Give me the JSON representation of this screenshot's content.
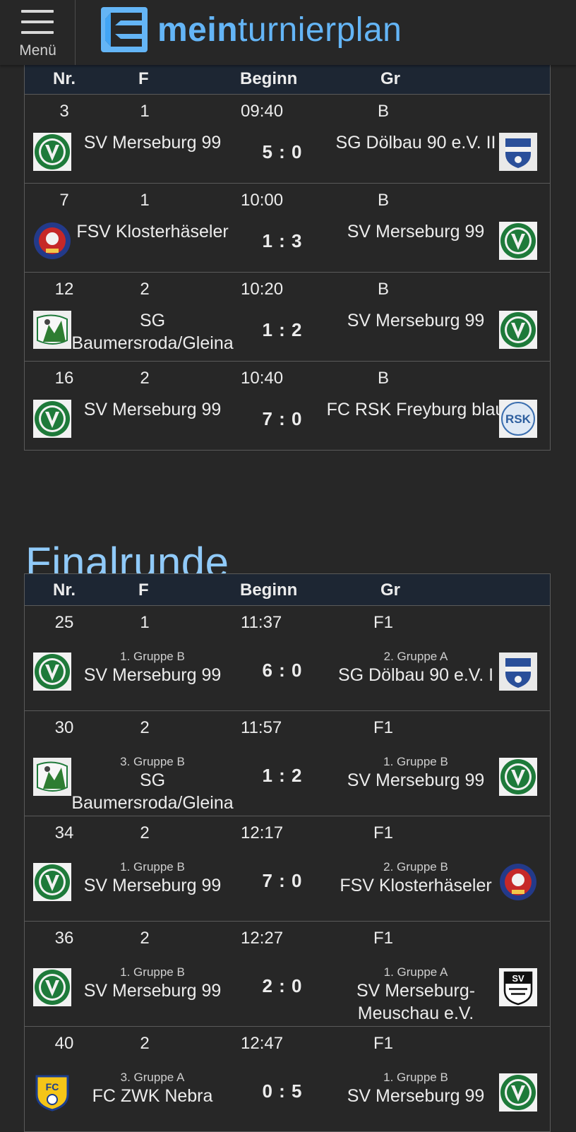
{
  "header": {
    "menu_label": "Menü",
    "logo_bold": "mein",
    "logo_rest": "turnierplan"
  },
  "columns": {
    "nr": "Nr.",
    "f": "F",
    "beginn": "Beginn",
    "gr": "Gr"
  },
  "group_matches": [
    {
      "nr": "3",
      "f": "1",
      "time": "09:40",
      "gr": "B",
      "home": "SV Merseburg 99",
      "home_logo": "sv-merseburg-99-crest",
      "score": "5 : 0",
      "away": "SG Dölbau 90 e.V. II",
      "away_logo": "sg-doelbau-crest"
    },
    {
      "nr": "7",
      "f": "1",
      "time": "10:00",
      "gr": "B",
      "home": "FSV Klosterhäseler",
      "home_logo": "fsv-klosterhaeseler-crest",
      "score": "1 : 3",
      "away": "SV Merseburg 99",
      "away_logo": "sv-merseburg-99-crest"
    },
    {
      "nr": "12",
      "f": "2",
      "time": "10:20",
      "gr": "B",
      "home": "SG Baumersroda/Gleina",
      "home_logo": "sg-baumersroda-crest",
      "score": "1 : 2",
      "away": "SV Merseburg 99",
      "away_logo": "sv-merseburg-99-crest"
    },
    {
      "nr": "16",
      "f": "2",
      "time": "10:40",
      "gr": "B",
      "home": "SV Merseburg 99",
      "home_logo": "sv-merseburg-99-crest",
      "score": "7 : 0",
      "away": "FC RSK Freyburg blau",
      "away_logo": "fc-rsk-freyburg-crest"
    }
  ],
  "final_round": {
    "title": "Finalrunde",
    "matches": [
      {
        "nr": "25",
        "f": "1",
        "time": "11:37",
        "gr": "F1",
        "home_src": "1. Gruppe B",
        "home": "SV Merseburg 99",
        "home_logo": "sv-merseburg-99-crest",
        "score": "6 : 0",
        "away_src": "2. Gruppe A",
        "away": "SG Dölbau 90 e.V. I",
        "away_logo": "sg-doelbau-crest"
      },
      {
        "nr": "30",
        "f": "2",
        "time": "11:57",
        "gr": "F1",
        "home_src": "3. Gruppe B",
        "home": "SG Baumersroda/Gleina",
        "home_logo": "sg-baumersroda-crest",
        "score": "1 : 2",
        "away_src": "1. Gruppe B",
        "away": "SV Merseburg 99",
        "away_logo": "sv-merseburg-99-crest"
      },
      {
        "nr": "34",
        "f": "2",
        "time": "12:17",
        "gr": "F1",
        "home_src": "1. Gruppe B",
        "home": "SV Merseburg 99",
        "home_logo": "sv-merseburg-99-crest",
        "score": "7 : 0",
        "away_src": "2. Gruppe B",
        "away": "FSV Klosterhäseler",
        "away_logo": "fsv-klosterhaeseler-crest"
      },
      {
        "nr": "36",
        "f": "2",
        "time": "12:27",
        "gr": "F1",
        "home_src": "1. Gruppe B",
        "home": "SV Merseburg 99",
        "home_logo": "sv-merseburg-99-crest",
        "score": "2 : 0",
        "away_src": "1. Gruppe A",
        "away": "SV Merseburg-Meuschau e.V.",
        "away_logo": "sv-merseburg-meuschau-crest"
      },
      {
        "nr": "40",
        "f": "2",
        "time": "12:47",
        "gr": "F1",
        "home_src": "3. Gruppe A",
        "home": "FC ZWK Nebra",
        "home_logo": "fc-zwk-nebra-crest",
        "score": "0 : 5",
        "away_src": "1. Gruppe B",
        "away": "SV Merseburg 99",
        "away_logo": "sv-merseburg-99-crest"
      }
    ]
  },
  "colors": {
    "accent": "#90caf9",
    "logo_blue": "#64b5f6",
    "header_row": "#1d2633",
    "background": "#272727"
  }
}
